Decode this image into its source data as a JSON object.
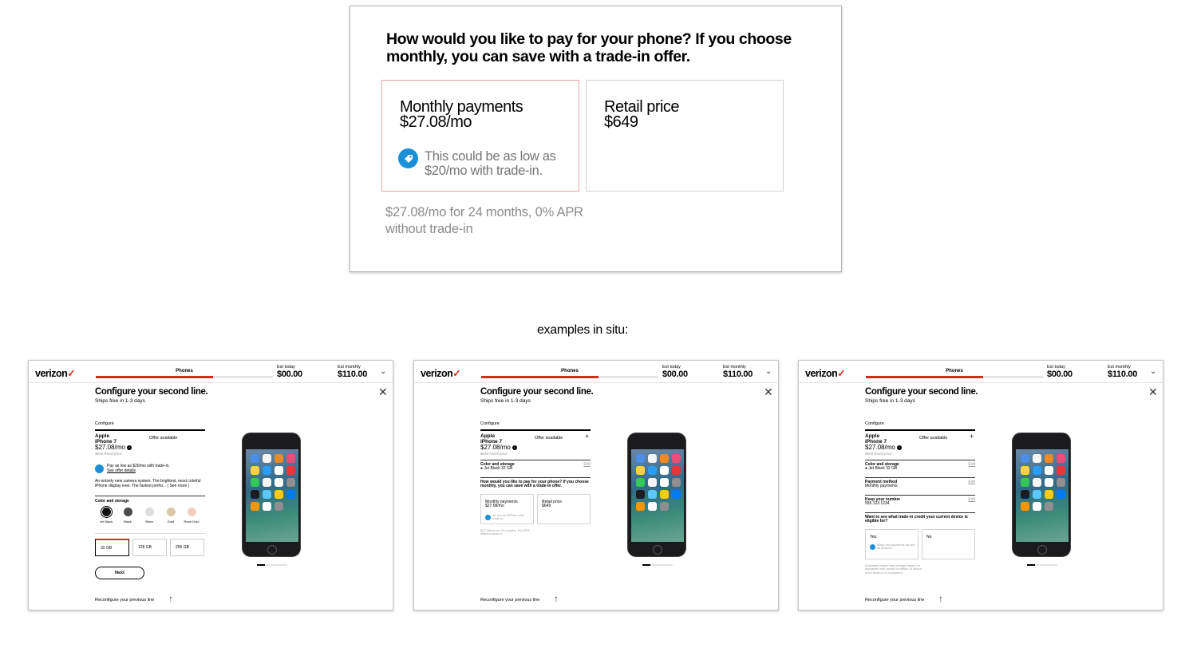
{
  "hero": {
    "title": "How would you like to pay for your phone? If you choose monthly, you can save with a trade-in offer.",
    "monthly": {
      "name": "Monthly payments",
      "price": "$27.08/mo",
      "tag_icon": "price-tag-icon",
      "tag_text": "This could be as low as $20/mo with trade-in."
    },
    "retail": {
      "name": "Retail price",
      "price": "$649"
    },
    "note": "$27.08/mo for 24 months, 0% APR without trade-in"
  },
  "caption": "examples in situ:",
  "screens": {
    "header": {
      "logo": "verizon",
      "logo_mark": "✓",
      "step": "Phones",
      "progress": 0.66,
      "est_today_label": "Est today",
      "est_today_value": "$00.00",
      "est_monthly_label": "Est monthly",
      "est_monthly_value": "$110.00",
      "chevron": "chevron-down-icon",
      "close": "close-icon"
    },
    "title": "Configure your second line.",
    "ship": "Ships free in 1-3 days",
    "configure_label": "Configure",
    "product": {
      "brand": "Apple",
      "model": "iPhone 7",
      "price": "$27.08/mo",
      "retail": "$649 Retail price",
      "offer": "Offer available",
      "plus": "+"
    },
    "tradein": {
      "line1": "Pay as low as $20/mo with trade-in.",
      "link": "See offer details"
    },
    "description": "An entirely new camera system. The brightest, most colorful iPhone display ever. The fastest perfor... ( See more )",
    "color_storage_label": "Color and storage",
    "colors": [
      {
        "name": "Jet Black",
        "hex": "#111111"
      },
      {
        "name": "Black",
        "hex": "#4a4a4a"
      },
      {
        "name": "Silver",
        "hex": "#dcdcdc"
      },
      {
        "name": "Gold",
        "hex": "#d9c7a8"
      },
      {
        "name": "Rose Gold",
        "hex": "#f2d0c0"
      }
    ],
    "storage": [
      "32 GB",
      "128 GB",
      "256 GB"
    ],
    "next": "Next",
    "color_storage_value": "Jet Black 32 GB",
    "edit": "Edit",
    "payment_q": "How would you like to pay for your phone? If you choose monthly, you can save with a trade-in offer.",
    "mini_monthly_name": "Monthly payments",
    "mini_monthly_price": "$27.08/mo",
    "mini_monthly_tag": "As low as $20/mo with trade-in.",
    "mini_retail_name": "Retail price",
    "mini_retail_price": "$649",
    "mini_note": "$27.08/mo for 24 months, 0% APR without trade-in",
    "payment_method_label": "Payment method",
    "payment_method_value": "Monthly payments",
    "keep_number_label": "Keep your number",
    "keep_number_value": "555.123.1234",
    "tradein_q": "Want to see what trade-in credit your current device is eligible for?",
    "yes": "Yes.",
    "no": "No",
    "yes_tag": "Make my payments as low as $20/mo.",
    "tradein_fine": "Estimated value may change based on appraised and actual condition of device once trade-in is completed.",
    "reconfigure": "Reconfigure your previous line",
    "reconfigure_icon": "arrow-up-icon",
    "phone_image": "iphone-7-product-image"
  }
}
